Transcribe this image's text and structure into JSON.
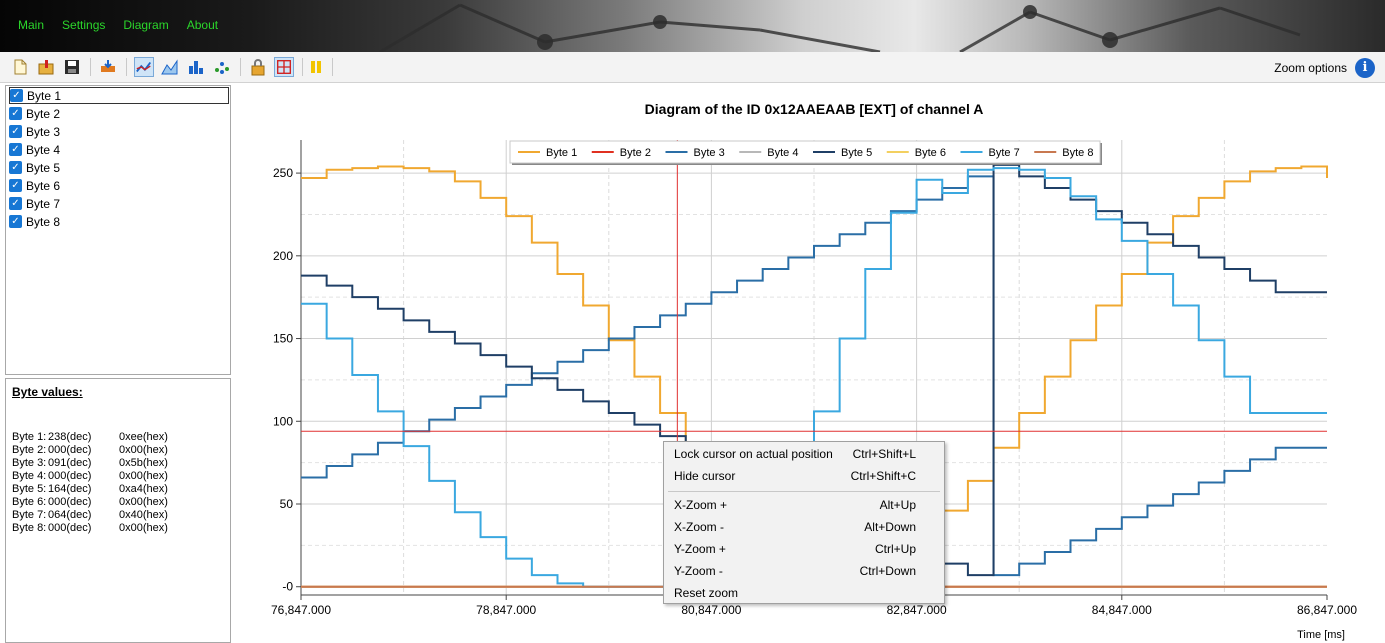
{
  "menu": {
    "items": [
      "Main",
      "Settings",
      "Diagram",
      "About"
    ]
  },
  "toolbar": {
    "zoom_options_label": "Zoom options",
    "buttons": [
      "new-document-icon",
      "open-folder-icon",
      "save-icon",
      "import-icon",
      "line-chart-icon",
      "area-chart-icon",
      "bar-chart-icon",
      "scatter-chart-icon",
      "lock-icon",
      "crosshair-icon",
      "pause-icon"
    ]
  },
  "byte_list": {
    "items": [
      {
        "label": "Byte 1",
        "checked": true
      },
      {
        "label": "Byte 2",
        "checked": true
      },
      {
        "label": "Byte 3",
        "checked": true
      },
      {
        "label": "Byte 4",
        "checked": true
      },
      {
        "label": "Byte 5",
        "checked": true
      },
      {
        "label": "Byte 6",
        "checked": true
      },
      {
        "label": "Byte 7",
        "checked": true
      },
      {
        "label": "Byte 8",
        "checked": true
      }
    ]
  },
  "byte_values": {
    "title": "Byte values:",
    "rows": [
      {
        "name": "Byte 1:",
        "dec": "238(dec)",
        "hex": "0xee(hex)"
      },
      {
        "name": "Byte 2:",
        "dec": "000(dec)",
        "hex": "0x00(hex)"
      },
      {
        "name": "Byte 3:",
        "dec": "091(dec)",
        "hex": "0x5b(hex)"
      },
      {
        "name": "Byte 4:",
        "dec": "000(dec)",
        "hex": "0x00(hex)"
      },
      {
        "name": "Byte 5:",
        "dec": "164(dec)",
        "hex": "0xa4(hex)"
      },
      {
        "name": "Byte 6:",
        "dec": "000(dec)",
        "hex": "0x00(hex)"
      },
      {
        "name": "Byte 7:",
        "dec": "064(dec)",
        "hex": "0x40(hex)"
      },
      {
        "name": "Byte 8:",
        "dec": "000(dec)",
        "hex": "0x00(hex)"
      }
    ]
  },
  "context_menu": {
    "items": [
      {
        "label": "Lock cursor on actual position",
        "shortcut": "Ctrl+Shift+L"
      },
      {
        "label": "Hide cursor",
        "shortcut": "Ctrl+Shift+C"
      },
      {
        "label": "X-Zoom +",
        "shortcut": "Alt+Up"
      },
      {
        "label": "X-Zoom -",
        "shortcut": "Alt+Down"
      },
      {
        "label": "Y-Zoom +",
        "shortcut": "Ctrl+Up"
      },
      {
        "label": "Y-Zoom -",
        "shortcut": "Ctrl+Down"
      },
      {
        "label": "Reset zoom",
        "shortcut": ""
      }
    ]
  },
  "chart_data": {
    "type": "line",
    "step": true,
    "title": "Diagram of the ID 0x12AAEAAB [EXT] of channel A",
    "xlabel": "Time [ms]",
    "ylabel": "",
    "xlim": [
      76847,
      86847
    ],
    "ylim": [
      -5,
      270
    ],
    "x_ticks": [
      76847,
      78847,
      80847,
      82847,
      84847,
      86847
    ],
    "x_tick_labels": [
      "76,847.000",
      "78,847.000",
      "80,847.000",
      "82,847.000",
      "84,847.000",
      "86,847.000"
    ],
    "y_ticks": [
      0,
      50,
      100,
      150,
      200,
      250
    ],
    "y_tick_labels": [
      "-0",
      "50",
      "100",
      "150",
      "200",
      "250"
    ],
    "grid": true,
    "legend_position": "top-center",
    "cursor": {
      "x": 80515,
      "y": 94
    },
    "series": [
      {
        "name": "Byte 1",
        "color": "#f0a830",
        "x": [
          76847,
          77097,
          77347,
          77597,
          77847,
          78097,
          78347,
          78597,
          78847,
          79097,
          79347,
          79597,
          79847,
          80097,
          80347,
          80597,
          80847,
          81097,
          81347,
          81597,
          81847,
          82097,
          82347,
          82597,
          82847,
          83097,
          83347,
          83597,
          83847,
          84097,
          84347,
          84597,
          84847,
          85097,
          85347,
          85597,
          85847,
          86097,
          86347,
          86597,
          86847
        ],
        "values": [
          247,
          252,
          253,
          254,
          253,
          251,
          245,
          235,
          224,
          208,
          189,
          170,
          149,
          127,
          105,
          84,
          64,
          45,
          31,
          19,
          10,
          4,
          1,
          0,
          0,
          46,
          64,
          84,
          105,
          127,
          149,
          170,
          189,
          208,
          224,
          235,
          245,
          251,
          253,
          254,
          247
        ]
      },
      {
        "name": "Byte 2",
        "color": "#e03020",
        "x": [
          76847,
          86847
        ],
        "values": [
          0,
          0
        ]
      },
      {
        "name": "Byte 3",
        "color": "#2a6ea6",
        "x": [
          76847,
          77097,
          77347,
          77597,
          77847,
          78097,
          78347,
          78597,
          78847,
          79097,
          79347,
          79597,
          79847,
          80097,
          80347,
          80597,
          80847,
          81097,
          81347,
          81597,
          81847,
          82097,
          82347,
          82597,
          82847,
          83097,
          83347,
          83597,
          83847,
          84097,
          84347,
          84597,
          84847,
          85097,
          85347,
          85597,
          85847,
          86097,
          86347,
          86597,
          86847
        ],
        "values": [
          66,
          73,
          80,
          87,
          94,
          101,
          108,
          115,
          122,
          129,
          136,
          143,
          150,
          157,
          164,
          171,
          178,
          185,
          192,
          199,
          206,
          213,
          220,
          227,
          234,
          241,
          248,
          7,
          14,
          21,
          28,
          35,
          42,
          49,
          56,
          63,
          70,
          77,
          84,
          84,
          84
        ]
      },
      {
        "name": "Byte 4",
        "color": "#b8b8b8",
        "x": [
          76847,
          86847
        ],
        "values": [
          0,
          0
        ]
      },
      {
        "name": "Byte 5",
        "color": "#1f3f66",
        "x": [
          76847,
          77097,
          77347,
          77597,
          77847,
          78097,
          78347,
          78597,
          78847,
          79097,
          79347,
          79597,
          79847,
          80097,
          80347,
          80597,
          80847,
          81097,
          81347,
          81597,
          81847,
          82097,
          82347,
          82597,
          82847,
          83097,
          83347,
          83597,
          83847,
          84097,
          84347,
          84597,
          84847,
          85097,
          85347,
          85597,
          85847,
          86097,
          86347,
          86597,
          86847
        ],
        "values": [
          188,
          182,
          175,
          168,
          161,
          154,
          147,
          140,
          133,
          126,
          119,
          112,
          105,
          98,
          91,
          84,
          77,
          70,
          63,
          56,
          49,
          42,
          35,
          28,
          21,
          14,
          7,
          255,
          248,
          241,
          234,
          227,
          220,
          213,
          206,
          199,
          192,
          185,
          178,
          178,
          178
        ]
      },
      {
        "name": "Byte 6",
        "color": "#f3d060",
        "x": [
          76847,
          86847
        ],
        "values": [
          0,
          0
        ]
      },
      {
        "name": "Byte 7",
        "color": "#3aa8e0",
        "x": [
          76847,
          77097,
          77347,
          77597,
          77847,
          78097,
          78347,
          78597,
          78847,
          79097,
          79347,
          79597,
          79847,
          80097,
          80347,
          80597,
          80847,
          81097,
          81347,
          81597,
          81847,
          82097,
          82347,
          82597,
          82847,
          83097,
          83347,
          83597,
          83847,
          84097,
          84347,
          84597,
          84847,
          85097,
          85347,
          85597,
          85847,
          86097,
          86347,
          86597,
          86847
        ],
        "values": [
          171,
          150,
          128,
          106,
          85,
          64,
          45,
          30,
          17,
          7,
          2,
          0,
          0,
          0,
          0,
          0,
          0,
          7,
          30,
          64,
          106,
          150,
          192,
          226,
          246,
          238,
          252,
          253,
          252,
          247,
          236,
          222,
          209,
          189,
          170,
          149,
          127,
          105,
          105,
          105,
          105
        ]
      },
      {
        "name": "Byte 8",
        "color": "#c87850",
        "x": [
          76847,
          86847
        ],
        "values": [
          0,
          0
        ]
      }
    ]
  }
}
